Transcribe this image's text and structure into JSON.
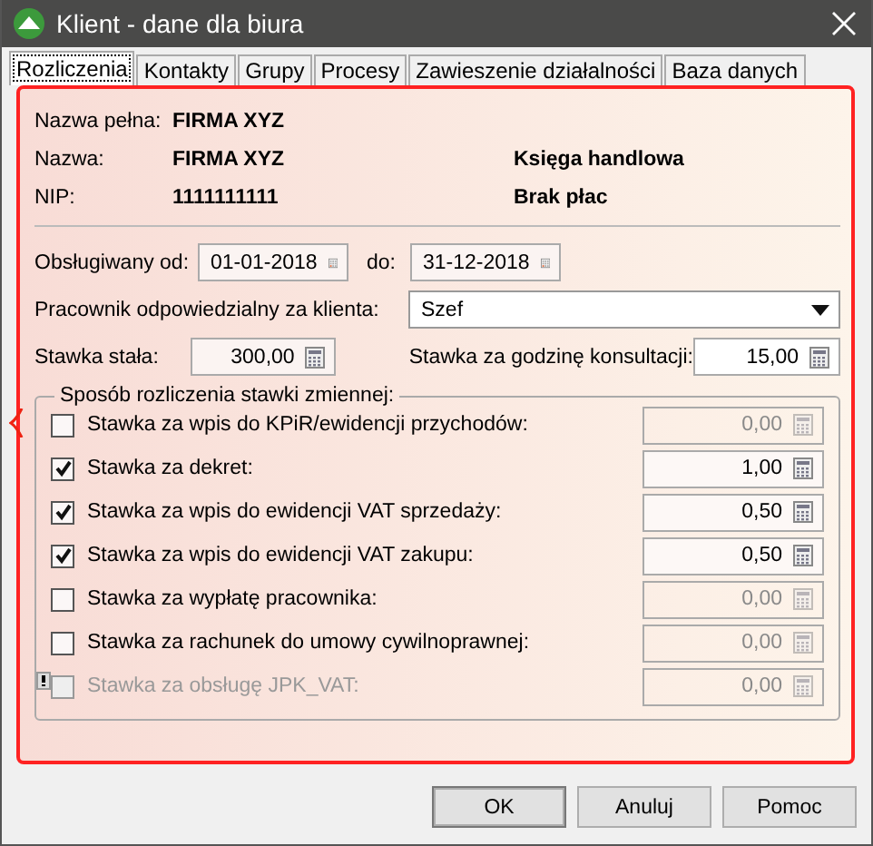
{
  "window": {
    "title": "Klient - dane dla biura"
  },
  "tabs": [
    {
      "label": "Rozliczenia",
      "selected": true
    },
    {
      "label": "Kontakty",
      "selected": false
    },
    {
      "label": "Grupy",
      "selected": false
    },
    {
      "label": "Procesy",
      "selected": false
    },
    {
      "label": "Zawieszenie działalności",
      "selected": false
    },
    {
      "label": "Baza danych",
      "selected": false
    }
  ],
  "info": [
    {
      "label": "Nazwa pełna:",
      "value": "FIRMA XYZ"
    },
    {
      "label": "Nazwa:",
      "value": "FIRMA XYZ",
      "extra": "Księga handlowa"
    },
    {
      "label": "NIP:",
      "value": "1111111111",
      "extra": "Brak płac"
    }
  ],
  "service": {
    "from_label": "Obsługiwany od:",
    "from": "01-01-2018",
    "to_label": "do:",
    "to": "31-12-2018"
  },
  "employee": {
    "label": "Pracownik odpowiedzialny za klienta:",
    "value": "Szef"
  },
  "fixed_rate": {
    "label": "Stawka stała:",
    "value": "300,00"
  },
  "hourly_rate": {
    "label": "Stawka za godzinę konsultacji:",
    "value": "15,00"
  },
  "variable": {
    "title": "Sposób rozliczenia stawki zmiennej:",
    "rows": [
      {
        "label": "Stawka za wpis do KPiR/ewidencji przychodów:",
        "checked": false,
        "disabled": false,
        "warning": false,
        "value": "0,00"
      },
      {
        "label": "Stawka za dekret:",
        "checked": true,
        "disabled": false,
        "warning": false,
        "value": "1,00"
      },
      {
        "label": "Stawka za wpis do ewidencji VAT sprzedaży:",
        "checked": true,
        "disabled": false,
        "warning": false,
        "value": "0,50"
      },
      {
        "label": "Stawka za wpis do ewidencji VAT zakupu:",
        "checked": true,
        "disabled": false,
        "warning": false,
        "value": "0,50"
      },
      {
        "label": "Stawka za wypłatę pracownika:",
        "checked": false,
        "disabled": false,
        "warning": false,
        "value": "0,00"
      },
      {
        "label": "Stawka za rachunek do umowy cywilnoprawnej:",
        "checked": false,
        "disabled": false,
        "warning": false,
        "value": "0,00"
      },
      {
        "label": "Stawka za obsługę JPK_VAT:",
        "checked": false,
        "disabled": true,
        "warning": true,
        "value": "0,00"
      }
    ]
  },
  "buttons": [
    "OK",
    "Anuluj",
    "Pomoc"
  ]
}
